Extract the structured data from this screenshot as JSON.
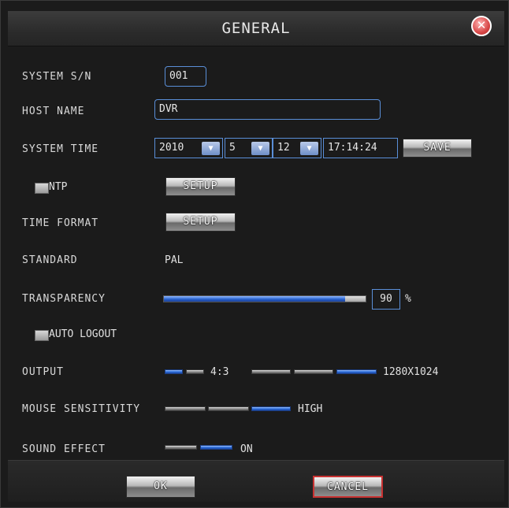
{
  "dialog": {
    "title": "GENERAL"
  },
  "system_sn": {
    "label": "SYSTEM S/N",
    "value": "001"
  },
  "host_name": {
    "label": "HOST NAME",
    "value": "DVR"
  },
  "system_time": {
    "label": "SYSTEM TIME",
    "year": "2010",
    "month": "5",
    "day": "12",
    "time": "17:14:24",
    "save_label": "SAVE"
  },
  "ntp": {
    "label": "NTP",
    "checked": false,
    "button_label": "SETUP"
  },
  "time_format": {
    "label": "TIME FORMAT",
    "button_label": "SETUP"
  },
  "standard": {
    "label": "STANDARD",
    "value": "PAL"
  },
  "transparency": {
    "label": "TRANSPARENCY",
    "value": "90",
    "unit": "%",
    "fraction": 0.9
  },
  "auto_logout": {
    "label": "AUTO LOGOUT",
    "checked": false
  },
  "output": {
    "label": "OUTPUT",
    "aspect_value": "4:3",
    "aspect_selected_index": 0,
    "aspect_options_count": 2,
    "resolution_value": "1280X1024",
    "resolution_selected_index": 2,
    "resolution_options_count": 3
  },
  "mouse_sensitivity": {
    "label": "MOUSE SENSITIVITY",
    "value": "HIGH",
    "selected_index": 2,
    "options_count": 3
  },
  "sound_effect": {
    "label": "SOUND EFFECT",
    "value": "ON",
    "selected_index": 1,
    "options_count": 2
  },
  "footer": {
    "ok_label": "OK",
    "cancel_label": "CANCEL"
  },
  "colors": {
    "accent_blue": "#2e6fdc",
    "field_border": "#5a8fd8",
    "cancel_border": "#c83232",
    "background": "#1b1b1b"
  },
  "icons": {
    "close": "close-icon",
    "dropdown": "chevron-down-icon"
  }
}
